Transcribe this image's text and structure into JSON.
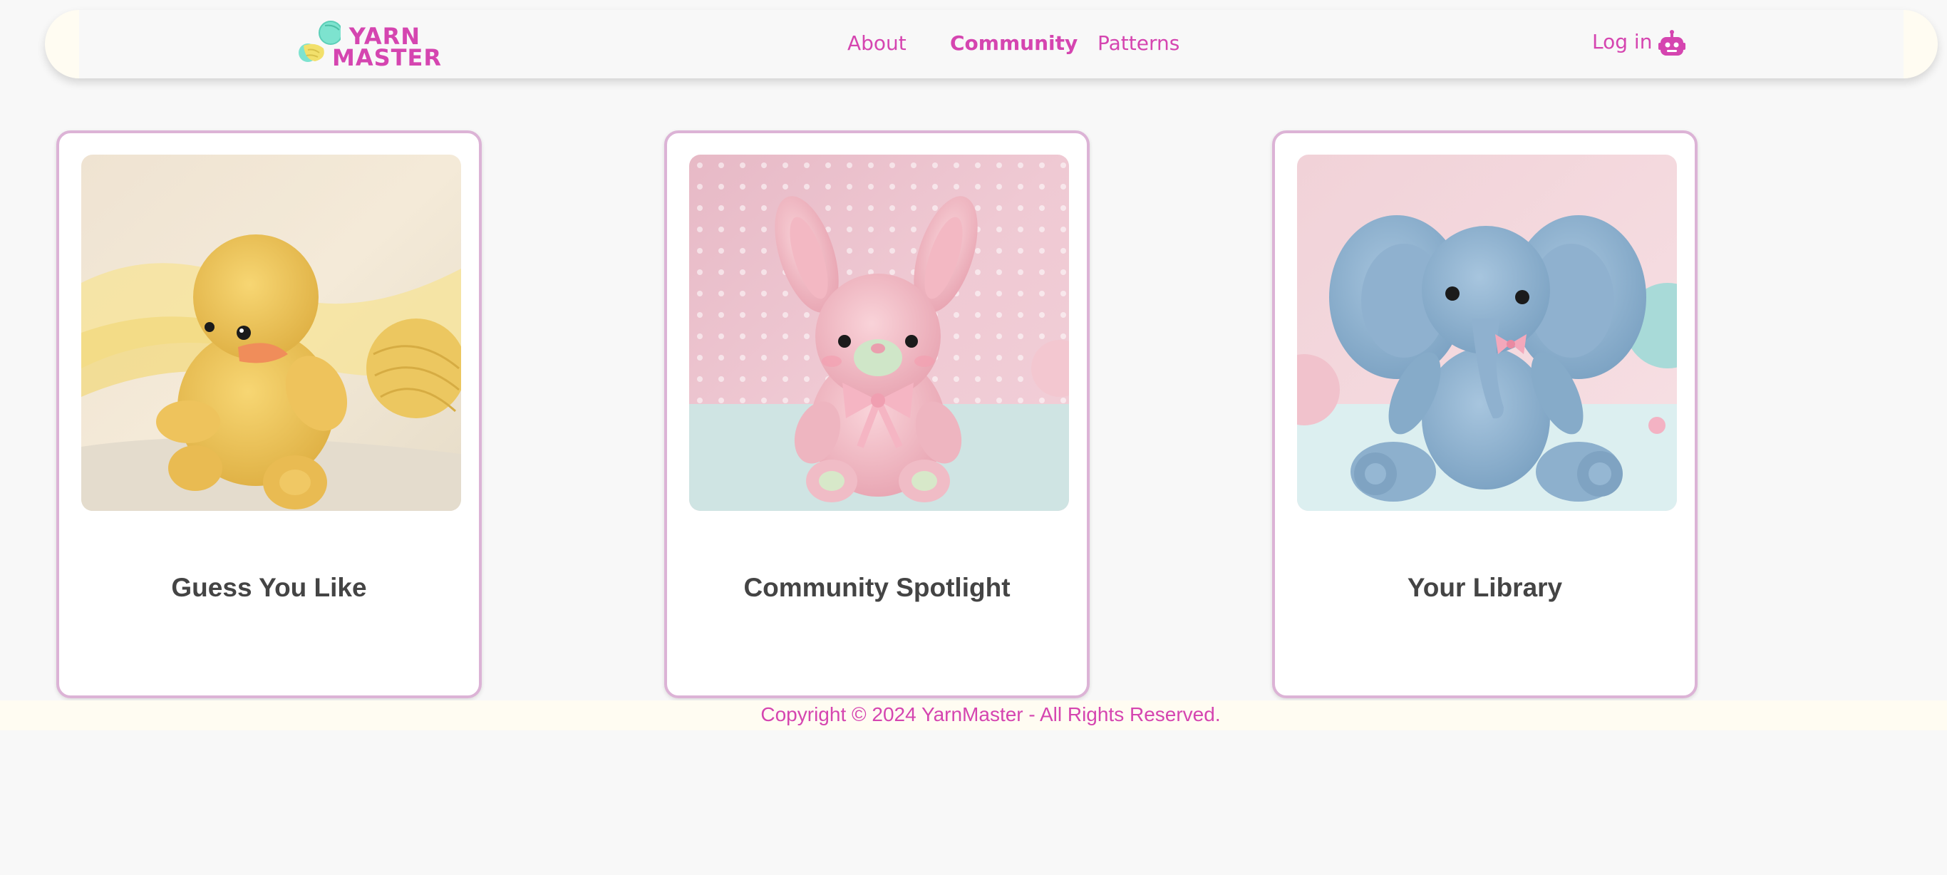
{
  "brand": {
    "line1": "YARN",
    "line2": "MASTER",
    "color": "#d545b0"
  },
  "nav": {
    "links": [
      {
        "label": "About",
        "active": false
      },
      {
        "label": "Community",
        "active": true
      },
      {
        "label": "Patterns",
        "active": false
      }
    ],
    "login_label": "Log in",
    "login_icon": "robot-icon"
  },
  "cards": [
    {
      "title": "Guess You Like",
      "image": "yellow-crochet-duck"
    },
    {
      "title": "Community Spotlight",
      "image": "pink-crochet-bunny"
    },
    {
      "title": "Your Library",
      "image": "blue-crochet-elephant"
    }
  ],
  "footer": {
    "text": "Copyright © 2024 YarnMaster - All Rights Reserved."
  },
  "colors": {
    "accent": "#d545b0",
    "card_border": "#dcb3d6",
    "footer_bg": "#fffcf2",
    "page_bg": "#f8f8f8"
  }
}
